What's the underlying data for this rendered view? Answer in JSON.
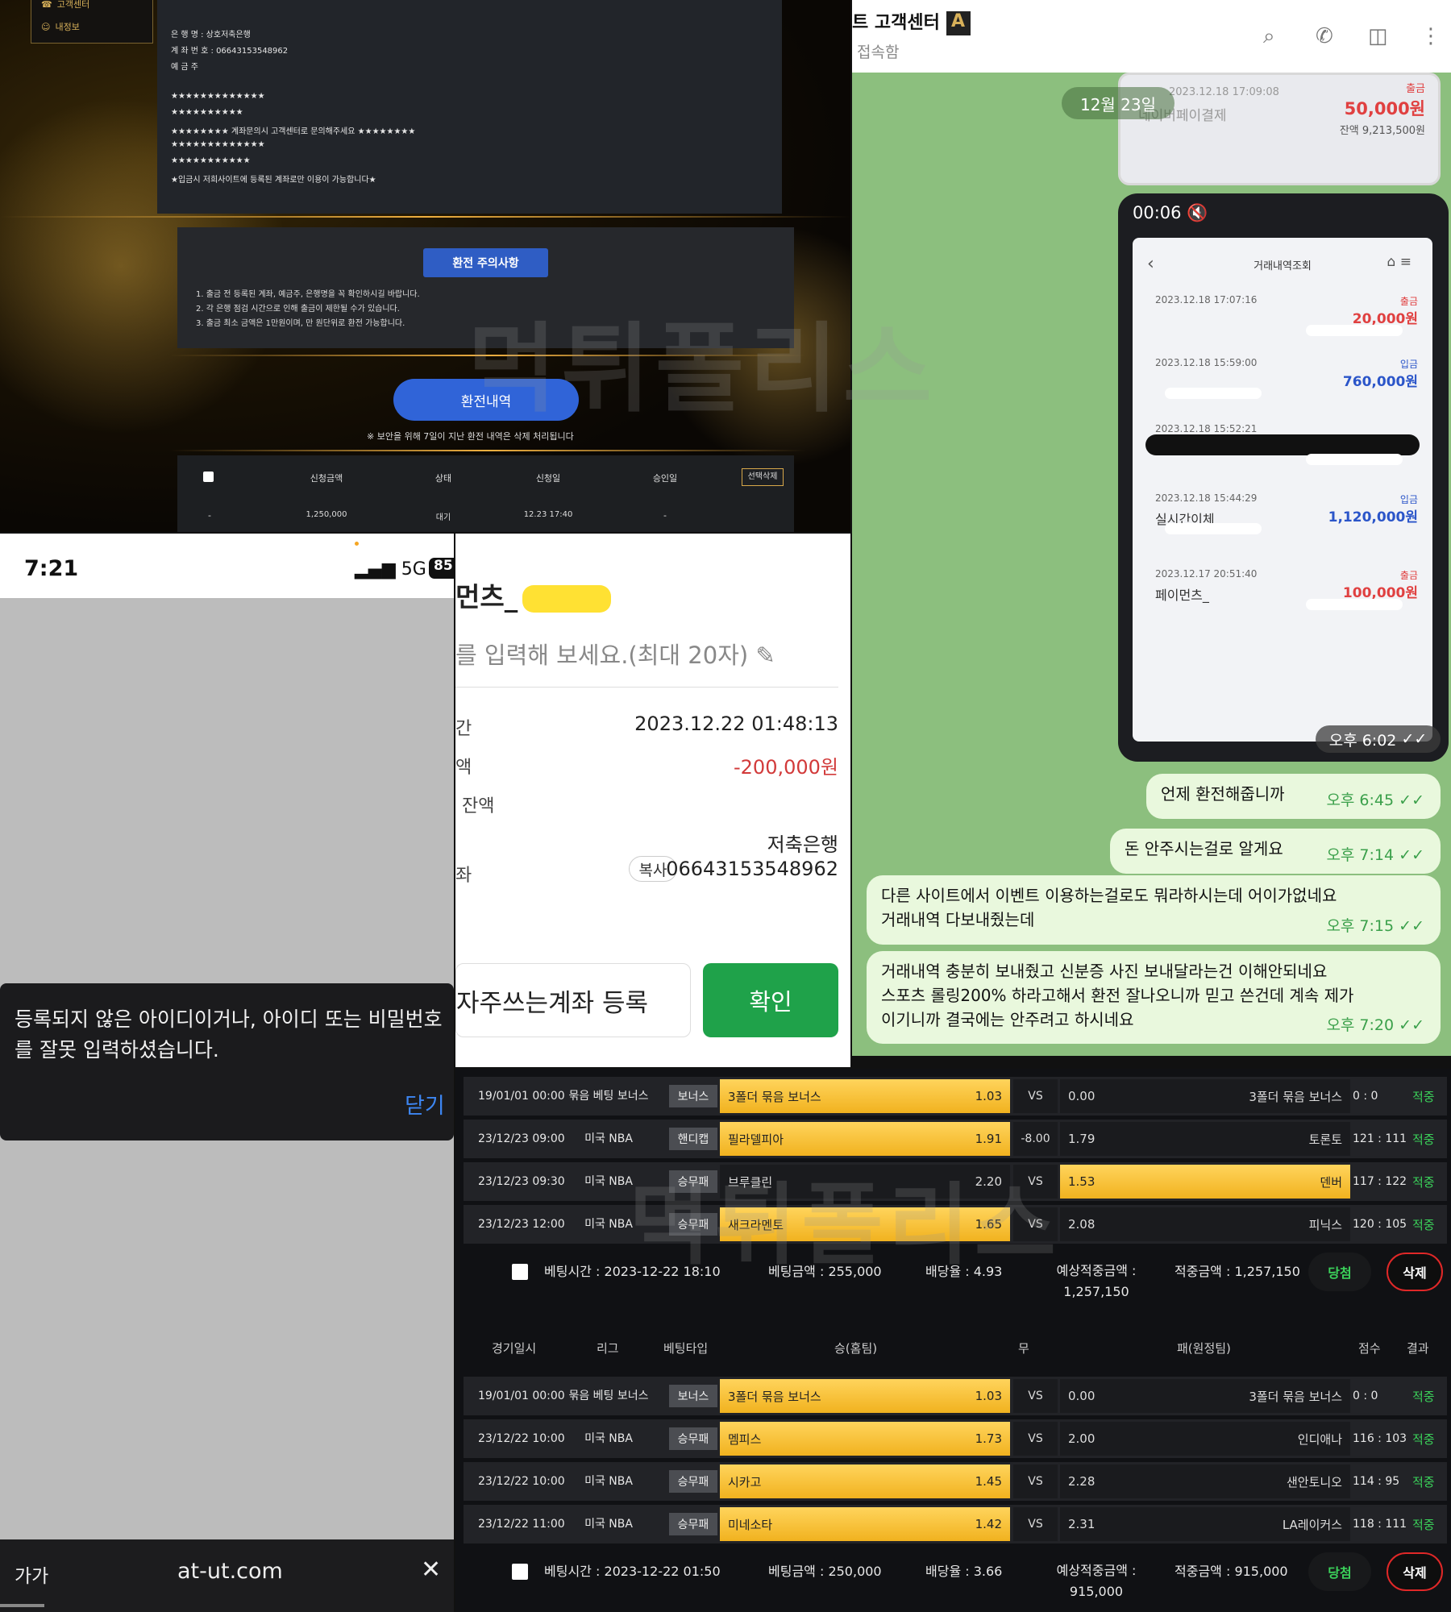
{
  "site": {
    "sidebar": [
      "고객센터",
      "내정보"
    ],
    "info_lines": [
      "은 행 명 : 상호저축은행",
      "계 좌 번 호 : 06643153548962",
      "예 금 주",
      "★★★★★★★★★★★★★",
      "★★★★★★★★★★",
      "★★★★★★★★ 계좌문의시 고객센터로 문의해주세요 ★★★★★★★★",
      "★★★★★★★★★★★★★",
      "★★★★★★★★★★★",
      "★입금시 저희사이트에 등록된 계좌로만 이용이 가능합니다★"
    ],
    "warn_title": "환전 주의사항",
    "warn_lines": [
      "1. 출금 전 등록된 계좌, 예금주, 은행명을 꼭 확인하시길 바랍니다.",
      "2. 각 은행 점검 시간으로 인해 출금이 제한될 수가 있습니다.",
      "3. 출금 최소 금액은 1만원이며, 만 원단위로 환전 가능합니다."
    ],
    "hist_button": "환전내역",
    "hist_note": "※ 보안을 위해 7일이 지난 환전 내역은 삭제 처리됩니다",
    "columns": [
      "신청금액",
      "상태",
      "신청일",
      "승인일",
      "선택삭제"
    ],
    "row": {
      "amount": "1,250,000",
      "status": "대기",
      "date": "12.23 17:40",
      "approved": "-",
      "dash": "-"
    }
  },
  "chat": {
    "title": "트 고객센터",
    "subtitle": "접속함",
    "date_pill": "12월 23일",
    "photo1": {
      "label": "출금",
      "amount": "50,000원",
      "balance": "잔액 9,213,500원",
      "date": "2023.12.18 17:09:08",
      "name": "네이버페이결제"
    },
    "video_time": "00:06",
    "screen_title": "거래내역조회",
    "transactions": [
      {
        "date": "2023.12.18 17:07:16",
        "type": "출금",
        "amount": "20,000원",
        "color": "#e04040"
      },
      {
        "date": "2023.12.18 15:59:00",
        "type": "입금",
        "amount": "760,000원",
        "color": "#2b55c9"
      },
      {
        "date": "2023.12.18 15:52:21",
        "type": "",
        "amount": "",
        "color": "#111"
      },
      {
        "date": "2023.12.18 15:44:29",
        "type": "입금",
        "amount": "1,120,000원",
        "color": "#2b55c9",
        "name": "실시간이체"
      },
      {
        "date": "2023.12.17 20:51:40",
        "type": "출금",
        "amount": "100,000원",
        "color": "#e04040",
        "name": "페이먼츠_"
      }
    ],
    "video_stamp": "오후 6:02",
    "messages": [
      {
        "text": "언제 환전해줍니까",
        "time": "오후 6:45"
      },
      {
        "text": "돈 안주시는걸로 알게요",
        "time": "오후 7:14"
      },
      {
        "text": "다른 사이트에서 이벤트 이용하는걸로도 뭐라하시는데 어이가없네요\n거래내역 다보내줬는데",
        "time": "오후 7:15"
      },
      {
        "text": "거래내역 충분히 보내줬고 신분증 사진 보내달라는건 이해안되네요\n스포츠 롤링200% 하라고해서 환전 잘나오니까 믿고 쓴건데 계속 제가\n이기니까 결국에는 안주려고 하시네요",
        "time": "오후 7:20"
      }
    ]
  },
  "phone": {
    "time": "7:21",
    "signal": "5G",
    "battery": "85",
    "dialog_message": "등록되지 않은 아이디이거나, 아이디 또는 비밀번호를 잘못 입력하셨습니다.",
    "dialog_close": "닫기",
    "aa": "가가",
    "url": "at-ut.com"
  },
  "receipt": {
    "title": "먼츠_",
    "memo_placeholder": "를 입력해 보세요.(최대 20자)",
    "label_time": "간",
    "value_time": "2023.12.22 01:48:13",
    "label_amount": "액",
    "value_amount": "-200,000원",
    "label_balance": "잔액",
    "bank": "저축은행",
    "label_account": "좌",
    "copy": "복사",
    "account": "06643153548962",
    "register_button": "자주쓰는계좌 등록",
    "confirm_button": "확인"
  },
  "bets": {
    "headers": [
      "경기일시",
      "리그",
      "베팅타입",
      "승(홈팀)",
      "무",
      "패(원정팀)",
      "점수",
      "결과"
    ],
    "slips": [
      {
        "rows": [
          {
            "dt": "19/01/01 00:00",
            "league": "묶음 베팅 보너스",
            "type": "보너스",
            "home": "3폴더 묶음 보너스",
            "hodds": "1.03",
            "mid": "VS",
            "aodds": "0.00",
            "away": "3폴더 묶음 보너스",
            "score": "0 : 0",
            "result": "적중",
            "pick": "home"
          },
          {
            "dt": "23/12/23 09:00",
            "league": "미국 NBA",
            "type": "핸디캡",
            "home": "필라델피아",
            "hodds": "1.91",
            "mid": "-8.00",
            "aodds": "1.79",
            "away": "토론토",
            "score": "121 : 111",
            "result": "적중",
            "pick": "home"
          },
          {
            "dt": "23/12/23 09:30",
            "league": "미국 NBA",
            "type": "승무패",
            "home": "브루클린",
            "hodds": "2.20",
            "mid": "VS",
            "aodds": "1.53",
            "away": "덴버",
            "score": "117 : 122",
            "result": "적중",
            "pick": "away"
          },
          {
            "dt": "23/12/23 12:00",
            "league": "미국 NBA",
            "type": "승무패",
            "home": "새크라멘토",
            "hodds": "1.65",
            "mid": "VS",
            "aodds": "2.08",
            "away": "피닉스",
            "score": "120 : 105",
            "result": "적중",
            "pick": "home"
          }
        ],
        "bet_time": "베팅시간 : 2023-12-22 18:10",
        "bet_amount": "베팅금액 : 255,000",
        "odds": "배당율 : 4.93",
        "expected": "예상적중금액 : 1,257,150",
        "win_amount": "적중금액 : 1,257,150",
        "status": "당첨",
        "delete": "삭제"
      },
      {
        "rows": [
          {
            "dt": "19/01/01 00:00",
            "league": "묶음 베팅 보너스",
            "type": "보너스",
            "home": "3폴더 묶음 보너스",
            "hodds": "1.03",
            "mid": "VS",
            "aodds": "0.00",
            "away": "3폴더 묶음 보너스",
            "score": "0 : 0",
            "result": "적중",
            "pick": "home"
          },
          {
            "dt": "23/12/22 10:00",
            "league": "미국 NBA",
            "type": "승무패",
            "home": "멤피스",
            "hodds": "1.73",
            "mid": "VS",
            "aodds": "2.00",
            "away": "인디애나",
            "score": "116 : 103",
            "result": "적중",
            "pick": "home"
          },
          {
            "dt": "23/12/22 10:00",
            "league": "미국 NBA",
            "type": "승무패",
            "home": "시카고",
            "hodds": "1.45",
            "mid": "VS",
            "aodds": "2.28",
            "away": "샌안토니오",
            "score": "114 : 95",
            "result": "적중",
            "pick": "home"
          },
          {
            "dt": "23/12/22 11:00",
            "league": "미국 NBA",
            "type": "승무패",
            "home": "미네소타",
            "hodds": "1.42",
            "mid": "VS",
            "aodds": "2.31",
            "away": "LA레이커스",
            "score": "118 : 111",
            "result": "적중",
            "pick": "home"
          }
        ],
        "bet_time": "베팅시간 : 2023-12-22 01:50",
        "bet_amount": "베팅금액 : 250,000",
        "odds": "배당율 : 3.66",
        "expected": "예상적중금액 : 915,000",
        "win_amount": "적중금액 : 915,000",
        "status": "당첨",
        "delete": "삭제"
      }
    ]
  },
  "watermark": "먹튀폴리스"
}
